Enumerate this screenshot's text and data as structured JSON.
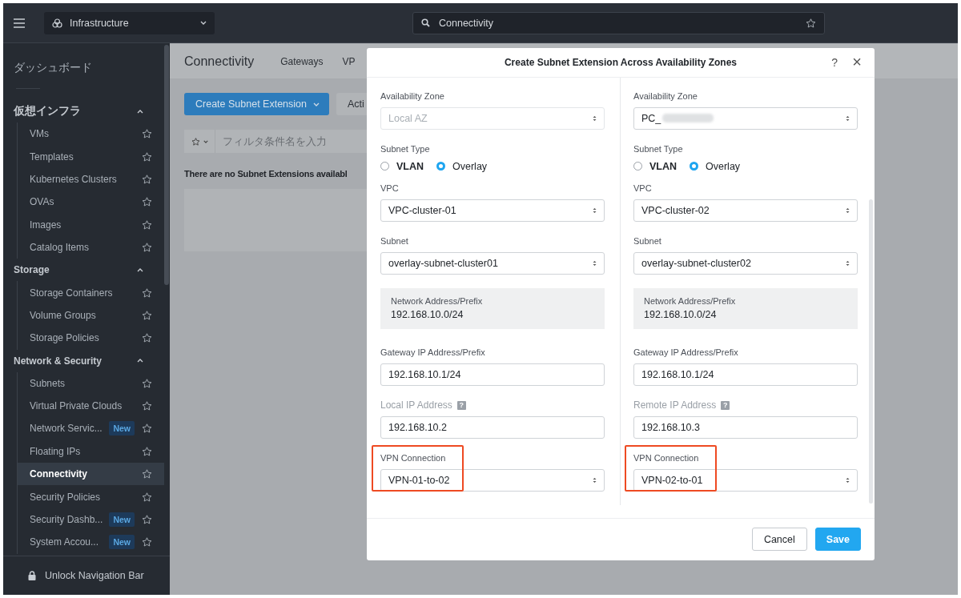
{
  "topbar": {
    "app_switcher": "Infrastructure",
    "search": {
      "value": "Connectivity"
    }
  },
  "sidebar": {
    "dashboard": "ダッシュボード",
    "sections": [
      {
        "title": "仮想インフラ",
        "expanded": true,
        "items": [
          {
            "label": "VMs",
            "selected": false
          },
          {
            "label": "Templates",
            "selected": false
          },
          {
            "label": "Kubernetes Clusters",
            "selected": false
          },
          {
            "label": "OVAs",
            "selected": false
          },
          {
            "label": "Images",
            "selected": false
          },
          {
            "label": "Catalog Items",
            "selected": false
          }
        ]
      },
      {
        "title": "Storage",
        "expanded": true,
        "items": [
          {
            "label": "Storage Containers",
            "selected": false
          },
          {
            "label": "Volume Groups",
            "selected": false
          },
          {
            "label": "Storage Policies",
            "selected": false
          }
        ]
      },
      {
        "title": "Network & Security",
        "expanded": true,
        "items": [
          {
            "label": "Subnets",
            "selected": false
          },
          {
            "label": "Virtual Private Clouds",
            "selected": false
          },
          {
            "label": "Network Servic...",
            "badge": "New",
            "selected": false
          },
          {
            "label": "Floating IPs",
            "selected": false
          },
          {
            "label": "Connectivity",
            "selected": true
          },
          {
            "label": "Security Policies",
            "selected": false
          },
          {
            "label": "Security Dashb...",
            "badge": "New",
            "selected": false
          },
          {
            "label": "System Accou...",
            "badge": "New",
            "selected": false
          }
        ]
      }
    ],
    "unlock": "Unlock Navigation Bar"
  },
  "page": {
    "title": "Connectivity",
    "tabs": [
      {
        "label": "Gateways"
      },
      {
        "label": "VP"
      }
    ],
    "create_button": "Create Subnet Extension",
    "actions_button": "Acti",
    "filter": {
      "placeholder": "フィルタ条件名を入力"
    },
    "empty_message": "There are no Subnet Extensions availabl"
  },
  "dialog": {
    "title": "Create Subnet Extension Across Availability Zones",
    "help": "?",
    "close": "×",
    "columns": [
      {
        "fields": [
          {
            "kind": "select",
            "label": "Availability Zone",
            "value": "Local AZ",
            "disabled": true
          },
          {
            "kind": "radio",
            "label": "Subnet Type",
            "options": [
              {
                "label": "VLAN",
                "selected": false
              },
              {
                "label": "Overlay",
                "selected": true
              }
            ]
          },
          {
            "kind": "select",
            "label": "VPC",
            "value": "VPC-cluster-01"
          },
          {
            "kind": "select",
            "label": "Subnet",
            "value": "overlay-subnet-cluster01"
          },
          {
            "kind": "info",
            "label": "Network Address/Prefix",
            "value": "192.168.10.0/24"
          },
          {
            "kind": "input",
            "label": "Gateway IP Address/Prefix",
            "value": "192.168.10.1/24"
          },
          {
            "kind": "input",
            "label": "Local IP Address",
            "value": "192.168.10.2",
            "label_muted": true,
            "help": "?"
          },
          {
            "kind": "select",
            "label": "VPN Connection",
            "value": "VPN-01-to-02",
            "highlighted": true
          }
        ]
      },
      {
        "fields": [
          {
            "kind": "select",
            "label": "Availability Zone",
            "value": "PC_",
            "redacted": true
          },
          {
            "kind": "radio",
            "label": "Subnet Type",
            "options": [
              {
                "label": "VLAN",
                "selected": false
              },
              {
                "label": "Overlay",
                "selected": true
              }
            ]
          },
          {
            "kind": "select",
            "label": "VPC",
            "value": "VPC-cluster-02"
          },
          {
            "kind": "select",
            "label": "Subnet",
            "value": "overlay-subnet-cluster02"
          },
          {
            "kind": "info",
            "label": "Network Address/Prefix",
            "value": "192.168.10.0/24"
          },
          {
            "kind": "input",
            "label": "Gateway IP Address/Prefix",
            "value": "192.168.10.1/24"
          },
          {
            "kind": "input",
            "label": "Remote IP Address",
            "value": "192.168.10.3",
            "label_muted": true,
            "help": "?"
          },
          {
            "kind": "select",
            "label": "VPN Connection",
            "value": "VPN-02-to-01",
            "highlighted": true
          }
        ]
      }
    ],
    "buttons": [
      {
        "label": "Cancel",
        "kind": "secondary"
      },
      {
        "label": "Save",
        "kind": "primary"
      }
    ]
  }
}
